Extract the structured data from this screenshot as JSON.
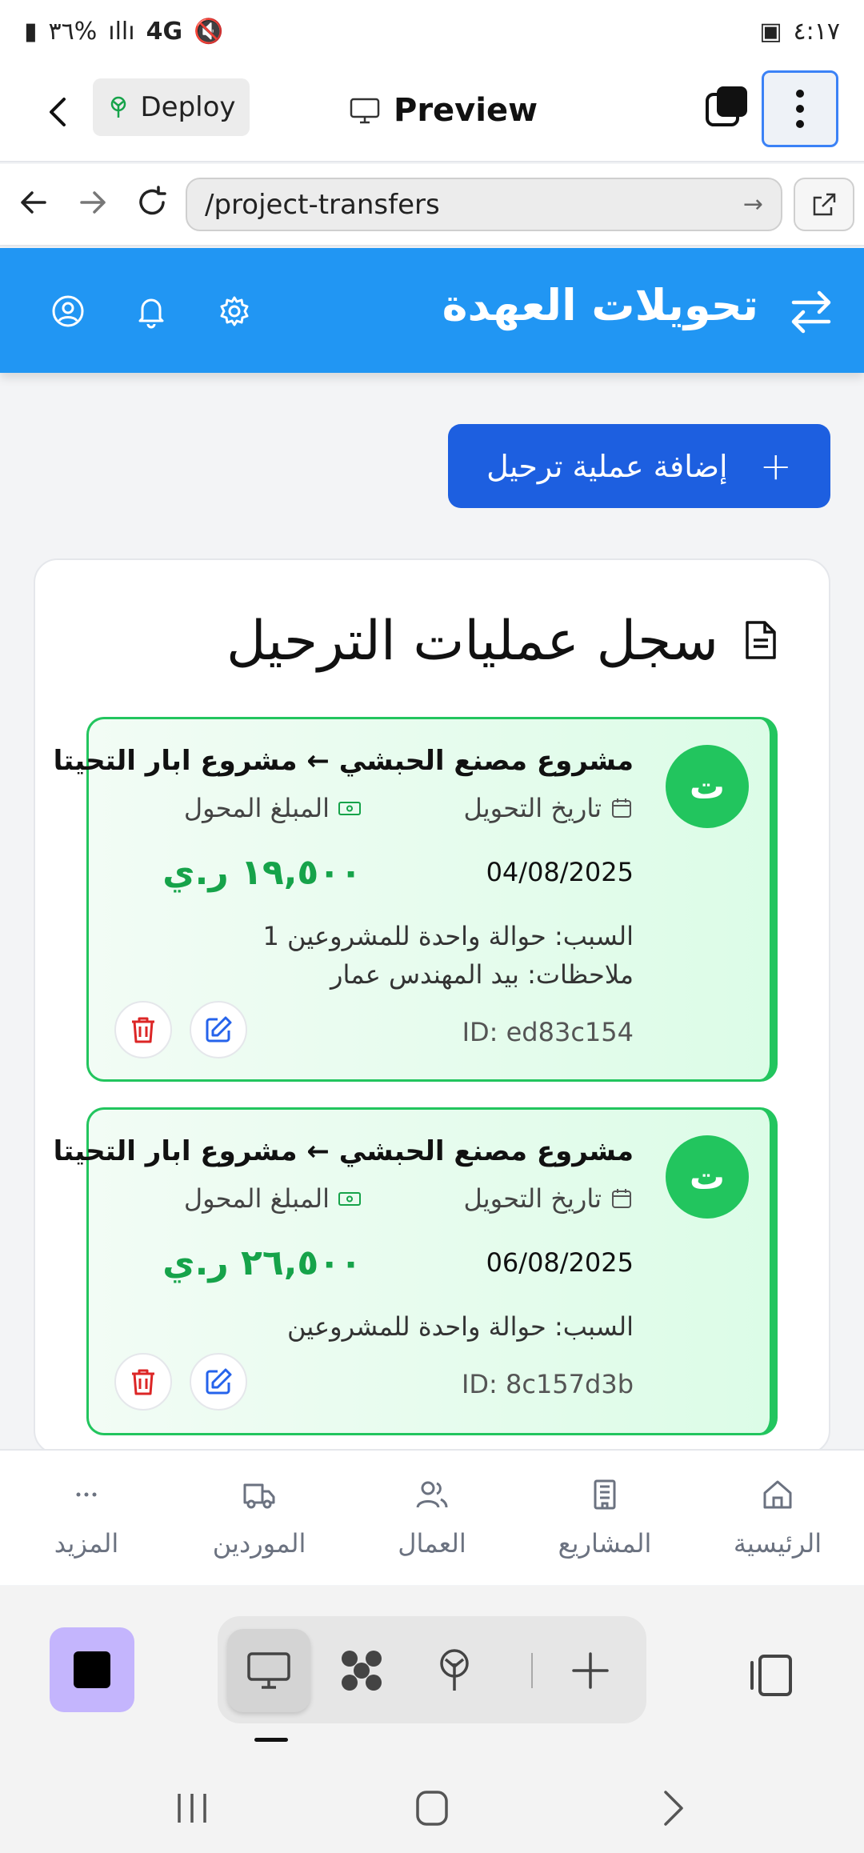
{
  "status_bar": {
    "time": "٤:١٧",
    "battery": "٣٦%",
    "network": "4G"
  },
  "preview_bar": {
    "deploy_label": "Deploy",
    "title": "Preview"
  },
  "url_bar": {
    "url": "/project-transfers"
  },
  "app_header": {
    "title": "تحويلات العهدة"
  },
  "main": {
    "add_button_label": "إضافة عملية ترحيل",
    "add_button_icon": "+",
    "log_title": "سجل عمليات الترحيل"
  },
  "entries": [
    {
      "avatar": "ت",
      "route": "مشروع مصنع الحبشي ← مشروع ابار التحيتا",
      "date_label": "تاريخ التحويل",
      "amount_label": "المبلغ المحول",
      "date": "04/08/2025",
      "amount": "١٩,٥٠٠ ر.ي",
      "reason": "السبب: حوالة واحدة للمشروعين 1",
      "notes": "ملاحظات: بيد المهندس عمار",
      "id": "ID: ed83c154"
    },
    {
      "avatar": "ت",
      "route": "مشروع مصنع الحبشي ← مشروع ابار التحيتا",
      "date_label": "تاريخ التحويل",
      "amount_label": "المبلغ المحول",
      "date": "06/08/2025",
      "amount": "٢٦,٥٠٠ ر.ي",
      "reason": "السبب: حوالة واحدة للمشروعين",
      "id": "ID: 8c157d3b"
    }
  ],
  "bottom_nav": [
    {
      "label": "الرئيسية",
      "icon": "home-icon"
    },
    {
      "label": "المشاريع",
      "icon": "building-icon"
    },
    {
      "label": "العمال",
      "icon": "users-icon"
    },
    {
      "label": "الموردين",
      "icon": "truck-icon"
    },
    {
      "label": "المزيد",
      "icon": "more-icon"
    }
  ],
  "colors": {
    "primary": "#2196f3",
    "button": "#1d5fe0",
    "success": "#22c55e",
    "amount": "#16a34a",
    "danger": "#dc2626",
    "edit": "#2563eb"
  }
}
